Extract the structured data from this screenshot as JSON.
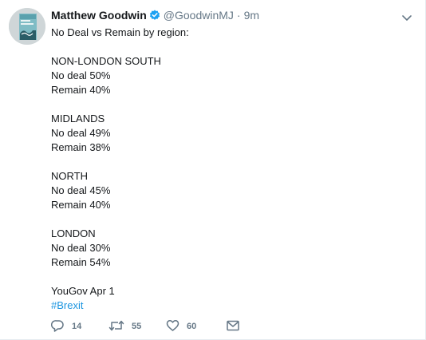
{
  "tweet": {
    "author_name": "Matthew Goodwin",
    "handle": "@GoodwinMJ",
    "separator": "·",
    "time": "9m",
    "lines": [
      "No Deal vs Remain by region:",
      "",
      "NON-LONDON SOUTH",
      "No deal 50%",
      "Remain 40%",
      "",
      "MIDLANDS",
      "No deal 49%",
      "Remain 38%",
      "",
      "NORTH",
      "No deal 45%",
      "Remain 40%",
      "",
      "LONDON",
      "No deal 30%",
      "Remain 54%",
      "",
      "YouGov Apr 1"
    ],
    "hashtag": "#Brexit"
  },
  "actions": {
    "reply_count": "14",
    "retweet_count": "55",
    "like_count": "60"
  },
  "icons": {
    "verified": "verified-badge-icon",
    "caret": "chevron-down-icon",
    "reply": "reply-icon",
    "retweet": "retweet-icon",
    "like": "heart-icon",
    "dm": "envelope-icon"
  },
  "colors": {
    "link": "#1b95e0",
    "verified": "#1da1f2",
    "muted": "#657786",
    "text": "#14171a"
  }
}
